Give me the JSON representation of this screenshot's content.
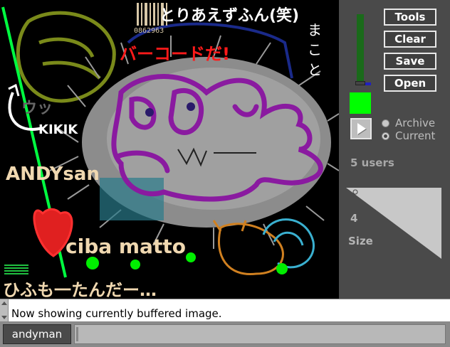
{
  "app": {
    "accent": "#00ff00"
  },
  "canvas": {
    "texts": {
      "top_japanese": "とりあえずふん(笑)",
      "barcode_number": "0862963",
      "barcode_red": "バーコードだ!",
      "side_japanese": "まこと",
      "wah": "ウッ",
      "kikik": "KIKIK",
      "andy": "ANDYsan",
      "ciba": "ciba matto",
      "bottom_japanese": "ひふも一たんだー…"
    }
  },
  "toolbar": {
    "tools_label": "Tools",
    "clear_label": "Clear",
    "save_label": "Save",
    "open_label": "Open"
  },
  "panel": {
    "color_swatch": "#00ff00",
    "archive_label": "Archive",
    "current_label": "Current",
    "users_label": "5 users",
    "size_value": "4",
    "size_label": "Size"
  },
  "status": {
    "message": "Now showing currently buffered image."
  },
  "footer": {
    "username": "andyman",
    "chat_value": ""
  }
}
